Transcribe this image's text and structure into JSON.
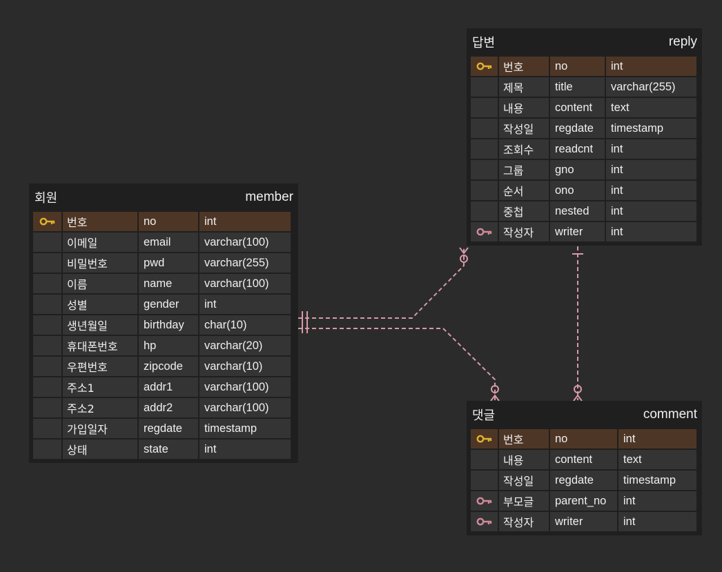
{
  "colors": {
    "background": "#2b2b2b",
    "table_bg": "#1f1f1f",
    "cell_bg": "#343434",
    "pk_row_bg": "#4e3626",
    "pk_key": "#e0b22c",
    "fk_key": "#d18a9a",
    "relation_line": "#d89aa8"
  },
  "tables": {
    "member": {
      "logical": "회원",
      "physical": "member",
      "rows": [
        {
          "key": "pk",
          "name": "번호",
          "col": "no",
          "type": "int"
        },
        {
          "key": "",
          "name": "이메일",
          "col": "email",
          "type": "varchar(100)"
        },
        {
          "key": "",
          "name": "비밀번호",
          "col": "pwd",
          "type": "varchar(255)"
        },
        {
          "key": "",
          "name": "이름",
          "col": "name",
          "type": "varchar(100)"
        },
        {
          "key": "",
          "name": "성별",
          "col": "gender",
          "type": "int"
        },
        {
          "key": "",
          "name": "생년월일",
          "col": "birthday",
          "type": "char(10)"
        },
        {
          "key": "",
          "name": "휴대폰번호",
          "col": "hp",
          "type": "varchar(20)"
        },
        {
          "key": "",
          "name": "우편번호",
          "col": "zipcode",
          "type": "varchar(10)"
        },
        {
          "key": "",
          "name": "주소1",
          "col": "addr1",
          "type": "varchar(100)"
        },
        {
          "key": "",
          "name": "주소2",
          "col": "addr2",
          "type": "varchar(100)"
        },
        {
          "key": "",
          "name": "가입일자",
          "col": "regdate",
          "type": "timestamp"
        },
        {
          "key": "",
          "name": "상태",
          "col": "state",
          "type": "int"
        }
      ]
    },
    "reply": {
      "logical": "답변",
      "physical": "reply",
      "rows": [
        {
          "key": "pk",
          "name": "번호",
          "col": "no",
          "type": "int"
        },
        {
          "key": "",
          "name": "제목",
          "col": "title",
          "type": "varchar(255)"
        },
        {
          "key": "",
          "name": "내용",
          "col": "content",
          "type": "text"
        },
        {
          "key": "",
          "name": "작성일",
          "col": "regdate",
          "type": "timestamp"
        },
        {
          "key": "",
          "name": "조회수",
          "col": "readcnt",
          "type": "int"
        },
        {
          "key": "",
          "name": "그룹",
          "col": "gno",
          "type": "int"
        },
        {
          "key": "",
          "name": "순서",
          "col": "ono",
          "type": "int"
        },
        {
          "key": "",
          "name": "중첩",
          "col": "nested",
          "type": "int"
        },
        {
          "key": "fk",
          "name": "작성자",
          "col": "writer",
          "type": "int"
        }
      ]
    },
    "comment": {
      "logical": "댓글",
      "physical": "comment",
      "rows": [
        {
          "key": "pk",
          "name": "번호",
          "col": "no",
          "type": "int"
        },
        {
          "key": "",
          "name": "내용",
          "col": "content",
          "type": "text"
        },
        {
          "key": "",
          "name": "작성일",
          "col": "regdate",
          "type": "timestamp"
        },
        {
          "key": "fk",
          "name": "부모글",
          "col": "parent_no",
          "type": "int"
        },
        {
          "key": "fk",
          "name": "작성자",
          "col": "writer",
          "type": "int"
        }
      ]
    }
  },
  "relations": [
    {
      "from": "member",
      "to": "reply",
      "from_cardinality": "one-and-only-one",
      "to_cardinality": "zero-or-many"
    },
    {
      "from": "member",
      "to": "comment",
      "from_cardinality": "one-and-only-one",
      "to_cardinality": "zero-or-many"
    },
    {
      "from": "reply",
      "to": "comment",
      "from_cardinality": "one",
      "to_cardinality": "zero-or-many"
    }
  ]
}
